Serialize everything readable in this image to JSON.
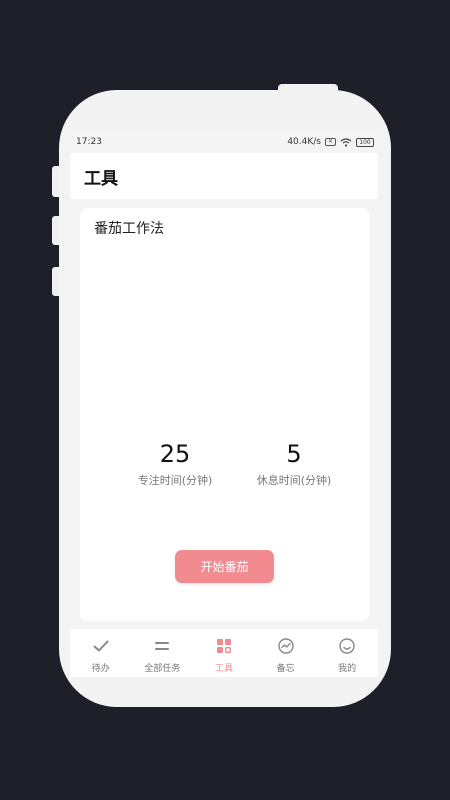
{
  "status_bar": {
    "time": "17:23",
    "net_speed": "40.4K/s",
    "sim": "×",
    "battery": "100"
  },
  "header": {
    "title": "工具"
  },
  "pomodoro": {
    "title": "番茄工作法",
    "focus_value": "25",
    "focus_label": "专注时间(分钟)",
    "rest_value": "5",
    "rest_label": "休息时间(分钟)",
    "start_label": "开始番茄"
  },
  "tabbar": {
    "items": [
      {
        "label": "待办",
        "icon": "check-icon"
      },
      {
        "label": "全部任务",
        "icon": "list-icon"
      },
      {
        "label": "工具",
        "icon": "grid-icon"
      },
      {
        "label": "备忘",
        "icon": "trend-icon"
      },
      {
        "label": "我的",
        "icon": "smile-icon"
      }
    ],
    "active_index": 2
  },
  "colors": {
    "accent": "#f28b8f",
    "background": "#1f1f29",
    "inactive_icon": "#888888"
  }
}
